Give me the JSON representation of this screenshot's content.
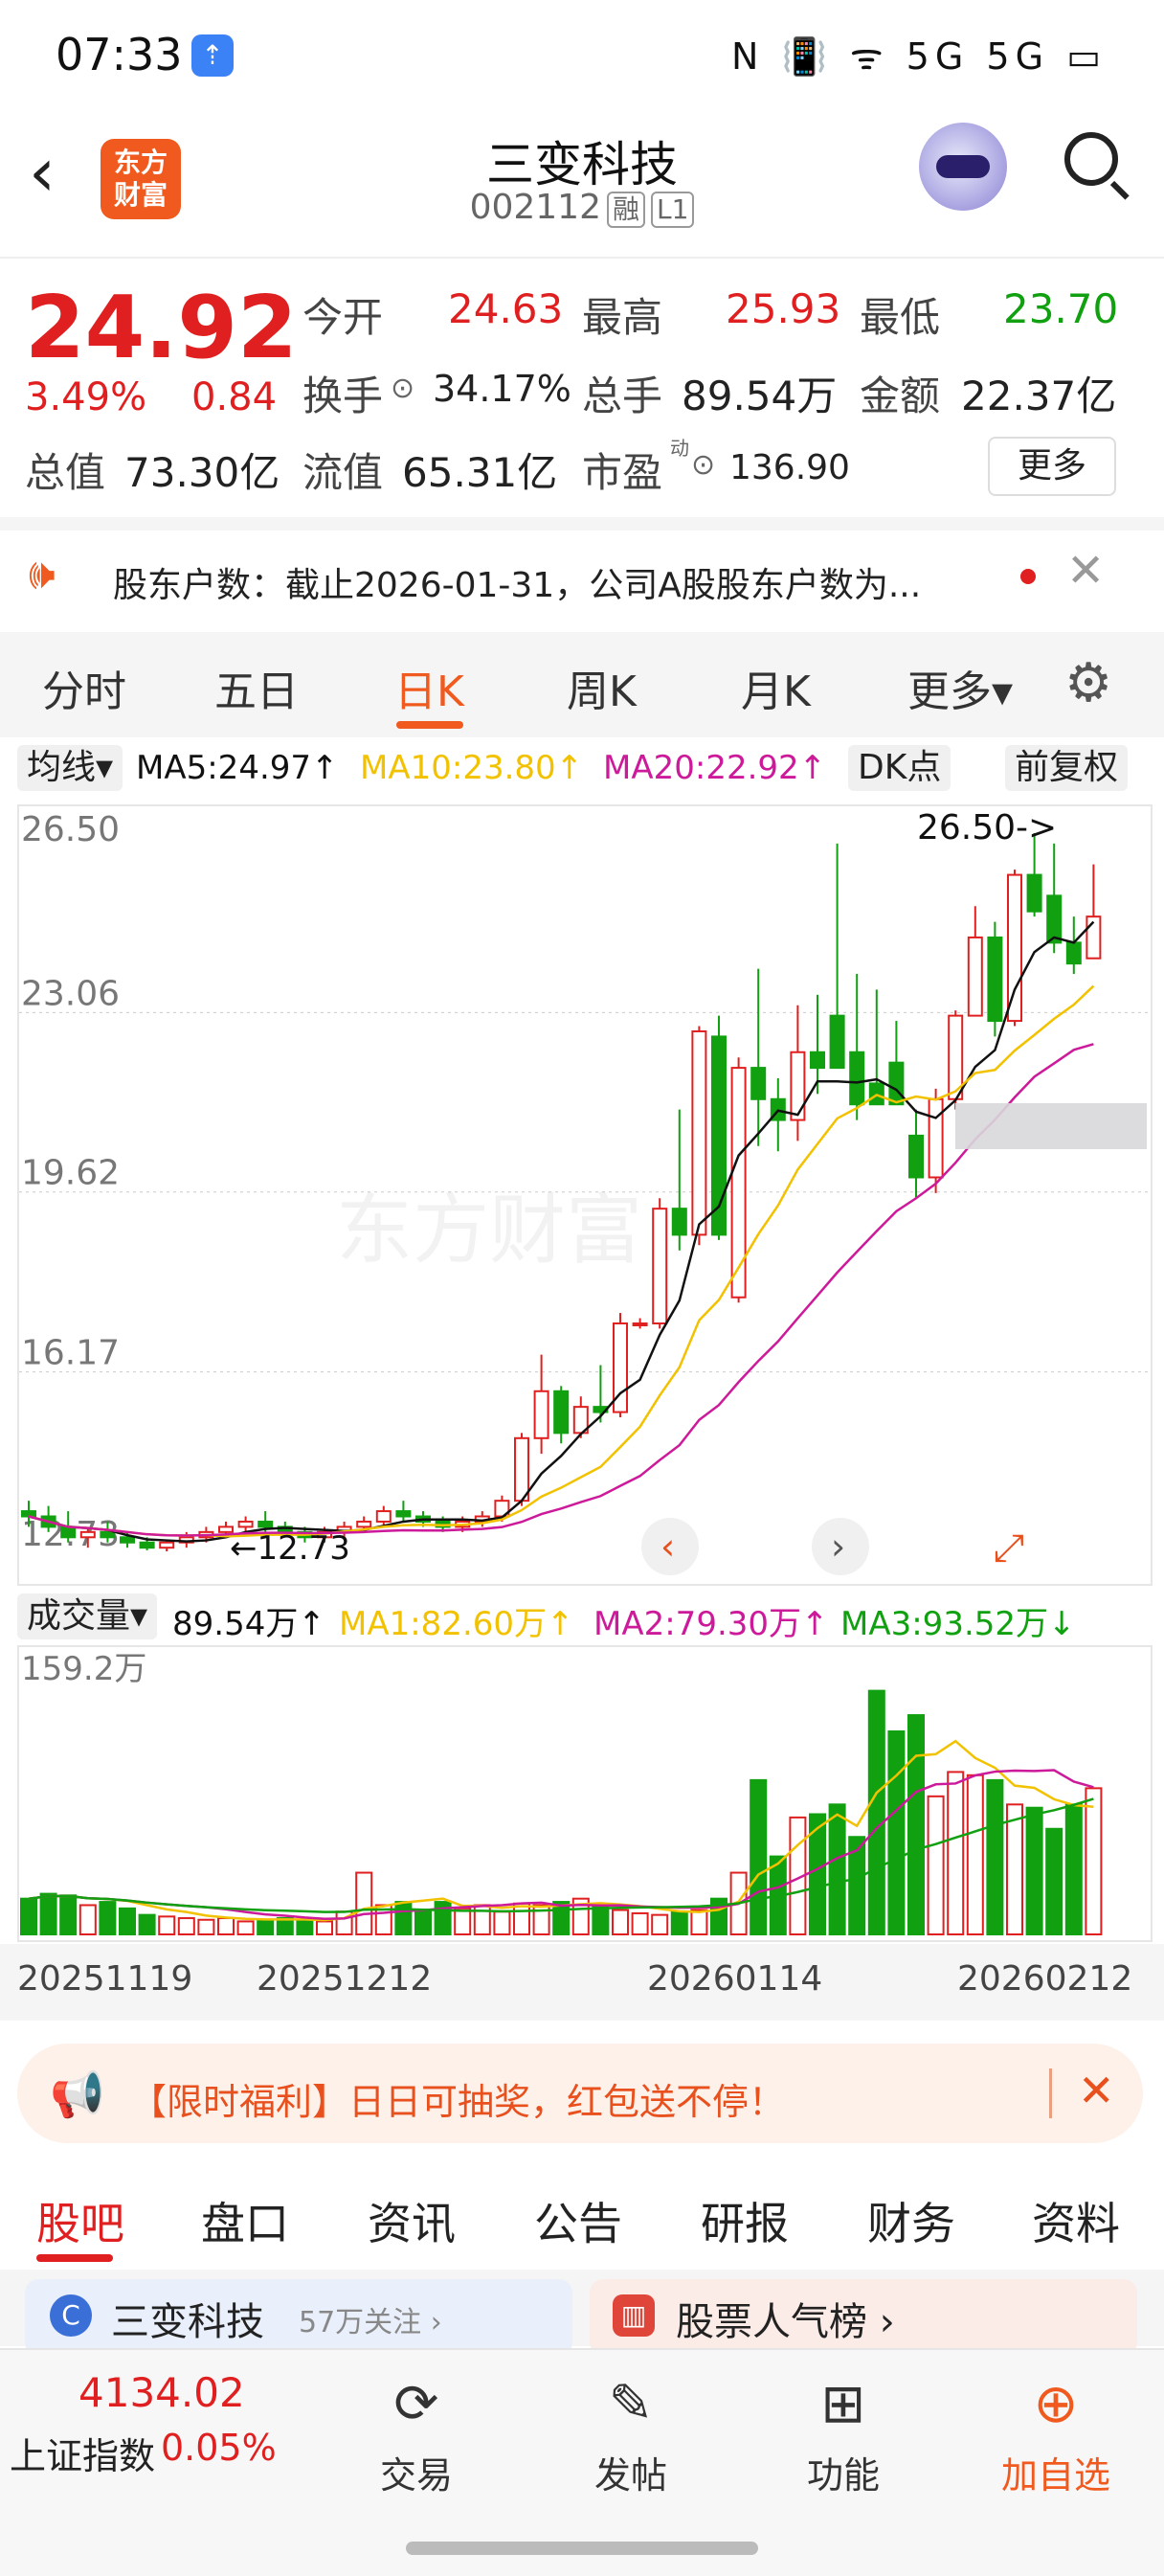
{
  "status": {
    "time": "07:33",
    "icons": "N 📳 ᯤ 5G 5G ▭"
  },
  "header": {
    "back": "‹",
    "logo": "东方\n财富",
    "name": "三变科技",
    "code": "002112",
    "tag1": "融",
    "tag2": "L1"
  },
  "quote": {
    "price": "24.92",
    "pct": "3.49%",
    "chg": "0.84",
    "open_label": "今开",
    "open": "24.63",
    "high_label": "最高",
    "high": "25.93",
    "low_label": "最低",
    "low": "23.70",
    "turnover_label": "换手",
    "turnover": "34.17%",
    "volume_label": "总手",
    "volume": "89.54万",
    "amount_label": "金额",
    "amount": "22.37亿",
    "mcap_label": "总值",
    "mcap": "73.30亿",
    "float_label": "流值",
    "float": "65.31亿",
    "pe_label": "市盈",
    "pe_sup": "动",
    "pe": "136.90",
    "more": "更多"
  },
  "notice": {
    "text": "股东户数：截止2026-01-31，公司A股股东户数为..."
  },
  "ktabs": [
    "分时",
    "五日",
    "日K",
    "周K",
    "月K",
    "更多▾"
  ],
  "ma": {
    "type": "均线▾",
    "ma5": "MA5:24.97↑",
    "ma10": "MA10:23.80↑",
    "ma20": "MA20:22.92↑",
    "dk": "DK点",
    "fq": "前复权"
  },
  "vol": {
    "type": "成交量▾",
    "v": "89.54万↑",
    "ma1": "MA1:82.60万↑",
    "ma2": "MA2:79.30万↑",
    "ma3": "MA3:93.52万↓"
  },
  "dates": [
    "20251119",
    "20251212",
    "20260114",
    "20260212"
  ],
  "promo": {
    "text": "【限时福利】日日可抽奖，红包送不停！"
  },
  "btabs": [
    "股吧",
    "盘口",
    "资讯",
    "公告",
    "研报",
    "财务",
    "资料"
  ],
  "cards": {
    "left": "三变科技",
    "left_sub": "57万关注 ›",
    "right": "股票人气榜 ›"
  },
  "bottom": {
    "index_value": "4134.02",
    "index_name": "上证指数",
    "index_pct": "0.05%",
    "b1": "交易",
    "b2": "发帖",
    "b3": "功能",
    "b4": "加自选"
  },
  "colors": {
    "up": "#e02020",
    "down": "#10a010",
    "accent": "#f05a1e",
    "ma5": "#111111",
    "ma10": "#f2c200",
    "ma20": "#cc1a9a"
  },
  "chart_data": [
    {
      "type": "candlestick",
      "title": "",
      "y_ticks": [
        26.5,
        23.06,
        19.62,
        16.17,
        12.73
      ],
      "ylim": [
        12.73,
        26.5
      ],
      "annotations": [
        "26.50->",
        "←12.73"
      ],
      "watermark": "东方财富",
      "ohlc": [
        [
          13.5,
          13.7,
          13.2,
          13.4
        ],
        [
          13.4,
          13.6,
          13.1,
          13.2
        ],
        [
          13.2,
          13.5,
          12.9,
          13.0
        ],
        [
          13.0,
          13.2,
          12.8,
          13.1
        ],
        [
          13.1,
          13.3,
          12.9,
          13.0
        ],
        [
          13.0,
          13.1,
          12.8,
          12.9
        ],
        [
          12.9,
          13.0,
          12.75,
          12.8
        ],
        [
          12.8,
          12.95,
          12.73,
          12.9
        ],
        [
          12.9,
          13.1,
          12.8,
          13.0
        ],
        [
          13.0,
          13.2,
          12.9,
          13.1
        ],
        [
          13.1,
          13.3,
          13.0,
          13.2
        ],
        [
          13.2,
          13.4,
          13.1,
          13.3
        ],
        [
          13.3,
          13.5,
          13.1,
          13.2
        ],
        [
          13.2,
          13.3,
          13.0,
          13.1
        ],
        [
          13.1,
          13.2,
          12.9,
          13.0
        ],
        [
          13.0,
          13.2,
          12.9,
          13.1
        ],
        [
          13.1,
          13.3,
          13.0,
          13.2
        ],
        [
          13.2,
          13.4,
          13.1,
          13.3
        ],
        [
          13.3,
          13.6,
          13.2,
          13.5
        ],
        [
          13.5,
          13.7,
          13.3,
          13.4
        ],
        [
          13.4,
          13.5,
          13.2,
          13.3
        ],
        [
          13.3,
          13.4,
          13.1,
          13.2
        ],
        [
          13.2,
          13.4,
          13.1,
          13.3
        ],
        [
          13.3,
          13.5,
          13.2,
          13.4
        ],
        [
          13.4,
          13.8,
          13.3,
          13.7
        ],
        [
          13.7,
          15.0,
          13.6,
          14.9
        ],
        [
          14.9,
          16.5,
          14.6,
          15.8
        ],
        [
          15.8,
          15.9,
          14.8,
          15.0
        ],
        [
          15.0,
          15.7,
          14.9,
          15.5
        ],
        [
          15.5,
          16.3,
          15.2,
          15.4
        ],
        [
          15.4,
          17.3,
          15.3,
          17.1
        ],
        [
          17.1,
          17.2,
          17.0,
          17.1
        ],
        [
          17.1,
          19.5,
          17.0,
          19.3
        ],
        [
          19.3,
          21.2,
          18.5,
          18.8
        ],
        [
          18.8,
          22.8,
          18.6,
          22.7
        ],
        [
          22.6,
          23.0,
          18.7,
          18.8
        ],
        [
          17.6,
          22.2,
          17.5,
          22.0
        ],
        [
          22.0,
          23.9,
          20.5,
          21.4
        ],
        [
          21.4,
          21.8,
          20.4,
          21.0
        ],
        [
          21.0,
          23.2,
          20.6,
          22.3
        ],
        [
          22.3,
          23.4,
          21.5,
          22.0
        ],
        [
          23.0,
          26.3,
          22.0,
          22.0
        ],
        [
          22.3,
          23.8,
          21.0,
          21.3
        ],
        [
          21.7,
          23.5,
          21.5,
          21.3
        ],
        [
          22.1,
          22.9,
          21.8,
          21.3
        ],
        [
          20.7,
          21.2,
          19.5,
          19.9
        ],
        [
          19.9,
          21.6,
          19.6,
          21.4
        ],
        [
          21.4,
          23.1,
          21.2,
          23.0
        ],
        [
          23.0,
          25.1,
          23.0,
          24.5
        ],
        [
          24.5,
          24.8,
          22.6,
          22.9
        ],
        [
          22.9,
          25.8,
          22.8,
          25.7
        ],
        [
          25.7,
          26.5,
          24.9,
          25.0
        ],
        [
          25.3,
          26.3,
          24.2,
          24.4
        ],
        [
          24.4,
          24.9,
          23.8,
          24.0
        ],
        [
          24.1,
          25.9,
          24.3,
          24.9
        ]
      ]
    },
    {
      "type": "bar",
      "title": "成交量",
      "y_ticks": [
        "159.2万"
      ],
      "ylim": [
        0,
        159.2
      ],
      "values": [
        22,
        25,
        24,
        18,
        20,
        16,
        12,
        11,
        10,
        9,
        10,
        8,
        9,
        10,
        9,
        8,
        14,
        38,
        18,
        20,
        14,
        20,
        16,
        18,
        14,
        19,
        18,
        20,
        22,
        17,
        15,
        13,
        12,
        14,
        15,
        22,
        38,
        95,
        48,
        72,
        74,
        80,
        60,
        150,
        125,
        135,
        85,
        100,
        98,
        95,
        80,
        78,
        65,
        80,
        90
      ]
    }
  ]
}
